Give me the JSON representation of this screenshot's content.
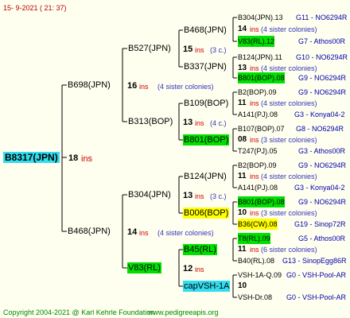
{
  "header": {
    "date": "15-  9-2021 (  21:  37)"
  },
  "footer": {
    "copyright": "Copyright 2004-2021 @ Karl Kehrle Foundation",
    "site": "www.pedigreeapis.org"
  },
  "tree": {
    "root": {
      "name": "B8317(JPN)",
      "count": "18",
      "ins": "ins"
    },
    "g1": [
      {
        "name": "B698(JPN)",
        "count": "16",
        "ins": "ins",
        "note": "(4 sister colonies)"
      },
      {
        "name": "B468(JPN)",
        "count": "14",
        "ins": "ins",
        "note": "(4 sister colonies)"
      }
    ],
    "g2": [
      {
        "name": "B527(JPN)",
        "count": "15",
        "ins": "ins",
        "note": "(3 c.)"
      },
      {
        "name": "B313(BOP)",
        "count": "13",
        "ins": "ins",
        "note": "(4 c.)"
      },
      {
        "name": "B304(JPN)",
        "count": "13",
        "ins": "ins",
        "note": "(3 c.)"
      },
      {
        "name": "V83(RL)",
        "count": "12",
        "ins": "ins",
        "note": ""
      }
    ],
    "g3": [
      {
        "name": "B468(JPN)"
      },
      {
        "name": "B337(JPN)"
      },
      {
        "name": "B109(BOP)"
      },
      {
        "name": "B801(BOP)"
      },
      {
        "name": "B124(JPN)"
      },
      {
        "name": "B006(BOP)"
      },
      {
        "name": "B45(RL)"
      },
      {
        "name": "capVSH-1A"
      }
    ],
    "g4": [
      {
        "name": "B304(JPN).13",
        "code": "G11 - NO6294R",
        "count": "14",
        "note": "(4 sister colonies)"
      },
      {
        "name": "V83(RL).12",
        "code": "G7 - Athos00R",
        "count": "",
        "note": ""
      },
      {
        "name": "B124(JPN).11",
        "code": "G10 - NO6294R",
        "count": "13",
        "note": "(4 sister colonies)"
      },
      {
        "name": "B801(BOP).08",
        "code": "G9 - NO6294R",
        "count": "",
        "note": ""
      },
      {
        "name": "B2(BOP).09",
        "code": "G9 - NO6294R",
        "count": "11",
        "note": "(4 sister colonies)"
      },
      {
        "name": "A141(PJ).08",
        "code": "G3 - Konya04-2",
        "count": "",
        "note": ""
      },
      {
        "name": "B107(BOP).07",
        "code": "G8 - NO6294R",
        "count": "08",
        "note": "(3 sister colonies)"
      },
      {
        "name": "T247(PJ).05",
        "code": "G3 - Athos00R",
        "count": "",
        "note": ""
      },
      {
        "name": "B2(BOP).09",
        "code": "G9 - NO6294R",
        "count": "11",
        "note": "(4 sister colonies)"
      },
      {
        "name": "A141(PJ).08",
        "code": "G3 - Konya04-2",
        "count": "",
        "note": ""
      },
      {
        "name": "B801(BOP).08",
        "code": "G9 - NO6294R",
        "count": "10",
        "note": "(3 sister colonies)"
      },
      {
        "name": "B36(CW).08",
        "code": "G19 - Sinop72R",
        "count": "",
        "note": ""
      },
      {
        "name": "T8(RL).09",
        "code": "G5 - Athos00R",
        "count": "11",
        "note": "(6 sister colonies)"
      },
      {
        "name": "B40(RL).08",
        "code": "G13 - SinopEgg86R",
        "count": "",
        "note": ""
      },
      {
        "name": "VSH-1A-Q.09",
        "code": "G0 - VSH-Pool-AR",
        "count": "10",
        "note": ""
      },
      {
        "name": "VSH-Dr.08",
        "code": "G0 - VSH-Pool-AR",
        "count": "",
        "note": ""
      }
    ]
  },
  "colors": {
    "green": "#00e000",
    "yellow": "#ffff00",
    "cyan": "#33ddee",
    "ins": "#cc0000",
    "code": "#0000aa"
  }
}
